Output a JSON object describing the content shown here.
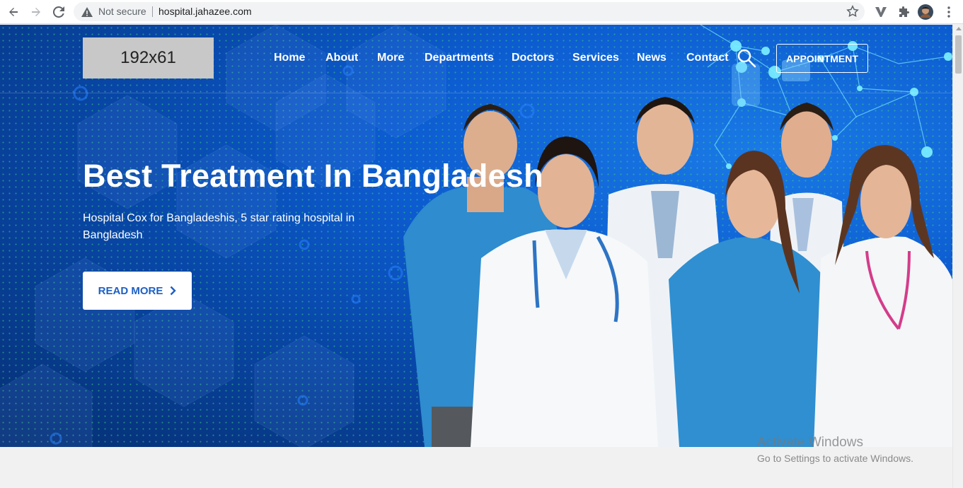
{
  "browser": {
    "security_label": "Not secure",
    "url": "hospital.jahazee.com"
  },
  "header": {
    "logo_text": "192x61",
    "menu": [
      "Home",
      "About",
      "More",
      "Departments",
      "Doctors",
      "Services",
      "News",
      "Contact"
    ],
    "appointment_label": "APPOINTMENT"
  },
  "hero": {
    "title": "Best Treatment In Bangladesh",
    "subtitle": "Hospital Cox for Bangladeshis, 5 star rating hospital in Bangladesh",
    "cta_label": "READ MORE"
  },
  "watermark": {
    "line1": "Activate Windows",
    "line2": "Go to Settings to activate Windows."
  },
  "colors": {
    "hero_blue": "#0c5bd0",
    "cta_text": "#1d5fc4",
    "scrubs_blue": "#2f8fd1"
  }
}
